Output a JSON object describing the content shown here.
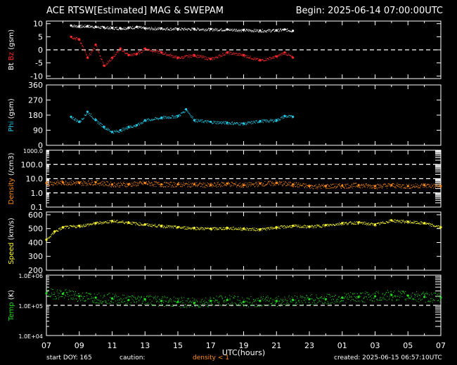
{
  "header": {
    "title": "ACE RTSW[Estimated] MAG & SWEPAM",
    "begin": "Begin: 2025-06-14 07:00:00UTC"
  },
  "footer": {
    "start_doy": "start DOY: 165",
    "caution_label": "caution:",
    "caution_note": "density < 1",
    "created": "created: 2025-06-15 06:57:10UTC"
  },
  "colors": {
    "axes": "#ffffff",
    "bt": "#ffffff",
    "bz": "#ff2a2a",
    "phi": "#22c8e6",
    "density": "#ff8c1a",
    "speed": "#ffff33",
    "temp": "#22dd22"
  },
  "chart_data": {
    "type": "scatter",
    "x": {
      "label": "UTC(hours)",
      "range_hours": [
        0,
        24
      ],
      "tick_labels": [
        "07",
        "09",
        "11",
        "13",
        "15",
        "17",
        "19",
        "21",
        "23",
        "01",
        "03",
        "05",
        "07"
      ]
    },
    "panels": [
      {
        "key": "mag",
        "ylabel_parts": [
          {
            "text": "Bt",
            "color_key": "bt"
          },
          {
            "text": "Bz",
            "color_key": "bz"
          },
          {
            "text": "(gsm)",
            "color_key": "axes"
          }
        ],
        "scale": "linear",
        "ylim": [
          -11,
          11
        ],
        "tick_labels": [
          "10",
          "5",
          "0",
          "-5",
          "-10"
        ],
        "tick_values": [
          10,
          5,
          0,
          -5,
          -10
        ],
        "dashed_at": [
          0
        ],
        "series": [
          {
            "name": "Bt",
            "color_key": "bt",
            "x": [
              1.5,
              2,
              2.5,
              3,
              3.5,
              4,
              4.5,
              5,
              5.5,
              6,
              7,
              8,
              9,
              10,
              11,
              12,
              13,
              14,
              14.5,
              15
            ],
            "y": [
              9.3,
              9.0,
              9.1,
              8.8,
              8.6,
              8.4,
              8.3,
              8.5,
              8.8,
              8.2,
              8.2,
              8.0,
              8.0,
              7.9,
              7.8,
              7.6,
              7.4,
              7.5,
              7.8,
              7.3
            ]
          },
          {
            "name": "Bz",
            "color_key": "bz",
            "x": [
              1.5,
              2,
              2.5,
              3,
              3.5,
              4,
              4.5,
              5,
              5.5,
              6,
              7,
              8,
              9,
              10,
              11,
              12,
              13,
              14,
              14.5,
              15
            ],
            "y": [
              5.0,
              4.0,
              -3.0,
              2.0,
              -6.0,
              -3.0,
              0.5,
              -2.0,
              -1.5,
              0.5,
              -1.0,
              -3.0,
              -2.0,
              -3.5,
              -1.0,
              -2.0,
              -4.0,
              -2.5,
              -1.0,
              -3.0
            ]
          }
        ]
      },
      {
        "key": "phi",
        "ylabel_parts": [
          {
            "text": "Phi",
            "color_key": "phi"
          },
          {
            "text": "(gsm)",
            "color_key": "axes"
          }
        ],
        "scale": "linear",
        "ylim": [
          0,
          360
        ],
        "tick_labels": [
          "360",
          "270",
          "180",
          "90",
          "0"
        ],
        "tick_values": [
          360,
          270,
          180,
          90,
          0
        ],
        "dashed_at": [],
        "series": [
          {
            "name": "Phi",
            "color_key": "phi",
            "x": [
              1.5,
              2,
              2.5,
              3,
              3.5,
              4,
              4.5,
              5,
              5.5,
              6,
              7,
              8,
              8.5,
              9,
              10,
              11,
              12,
              13,
              14,
              14.5,
              15
            ],
            "y": [
              170,
              140,
              200,
              150,
              110,
              80,
              90,
              110,
              120,
              150,
              165,
              175,
              215,
              150,
              140,
              135,
              130,
              145,
              150,
              175,
              170
            ]
          }
        ]
      },
      {
        "key": "density",
        "ylabel_parts": [
          {
            "text": "Density",
            "color_key": "density"
          },
          {
            "text": "(/cm3)",
            "color_key": "axes"
          }
        ],
        "scale": "log",
        "ylim": [
          0.1,
          1000
        ],
        "tick_labels": [
          "1000.0",
          "100.0",
          "10.0",
          "1.0",
          "0.1"
        ],
        "tick_values": [
          1000,
          100,
          10,
          1,
          0.1
        ],
        "dashed_at": [
          100,
          10,
          1
        ],
        "series": [
          {
            "name": "Density",
            "color_key": "density",
            "x": [
              0,
              1,
              2,
              3,
              4,
              5,
              6,
              7,
              8,
              9,
              10,
              11,
              12,
              13,
              14,
              15,
              16,
              17,
              18,
              19,
              20,
              21,
              22,
              23,
              24
            ],
            "y": [
              5.0,
              5.5,
              5.0,
              5.5,
              4.0,
              4.0,
              5.0,
              4.0,
              4.0,
              4.0,
              3.5,
              4.5,
              3.5,
              4.5,
              5.0,
              4.0,
              3.0,
              3.0,
              3.2,
              3.5,
              3.0,
              3.5,
              3.0,
              3.5,
              3.0
            ]
          }
        ]
      },
      {
        "key": "speed",
        "ylabel_parts": [
          {
            "text": "Speed",
            "color_key": "speed"
          },
          {
            "text": "(km/s)",
            "color_key": "axes"
          }
        ],
        "scale": "linear",
        "ylim": [
          200,
          620
        ],
        "tick_labels": [
          "600",
          "500",
          "400",
          "300",
          "200"
        ],
        "tick_values": [
          600,
          500,
          400,
          300,
          200
        ],
        "dashed_at": [],
        "series": [
          {
            "name": "Speed",
            "color_key": "speed",
            "x": [
              0,
              0.5,
              1,
              2,
              3,
              4,
              5,
              6,
              7,
              8,
              9,
              10,
              11,
              12,
              13,
              14,
              15,
              16,
              17,
              18,
              19,
              20,
              21,
              22,
              23,
              24
            ],
            "y": [
              420,
              480,
              510,
              520,
              540,
              555,
              545,
              530,
              520,
              510,
              505,
              500,
              505,
              500,
              495,
              510,
              520,
              515,
              525,
              540,
              545,
              530,
              560,
              550,
              540,
              510
            ]
          }
        ]
      },
      {
        "key": "temp",
        "ylabel_parts": [
          {
            "text": "Temp",
            "color_key": "temp"
          },
          {
            "text": "(K)",
            "color_key": "axes"
          }
        ],
        "scale": "log",
        "ylim": [
          10000,
          1000000
        ],
        "tick_labels": [
          "1.0E+06",
          "1.0E+05",
          "1.0E+04"
        ],
        "tick_values": [
          1000000,
          100000,
          10000
        ],
        "dashed_at": [
          100000
        ],
        "series": [
          {
            "name": "Temp",
            "color_key": "temp",
            "x": [
              0,
              1,
              2,
              3,
              4,
              5,
              6,
              7,
              8,
              9,
              10,
              11,
              12,
              13,
              14,
              15,
              16,
              17,
              18,
              19,
              20,
              21,
              22,
              23,
              24
            ],
            "y": [
              250000,
              240000,
              200000,
              180000,
              170000,
              150000,
              160000,
              140000,
              130000,
              120000,
              140000,
              150000,
              130000,
              140000,
              140000,
              150000,
              160000,
              160000,
              180000,
              190000,
              200000,
              220000,
              210000,
              190000,
              180000
            ]
          }
        ]
      }
    ]
  }
}
